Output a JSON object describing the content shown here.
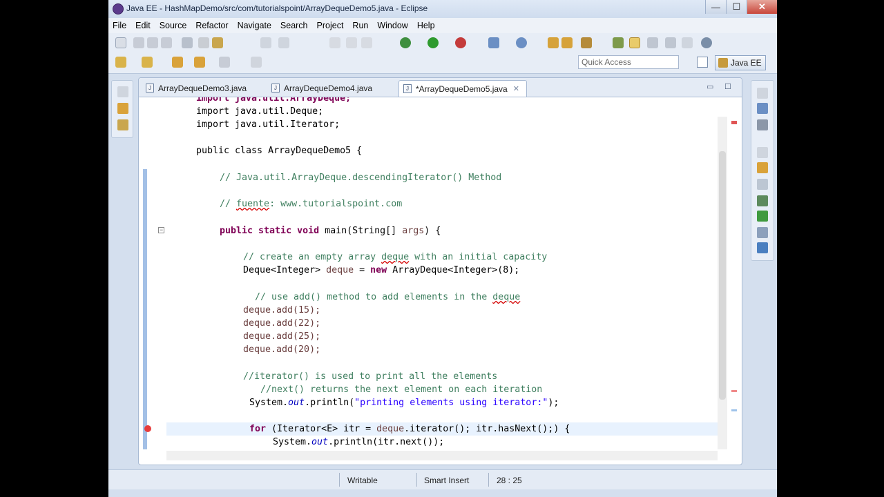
{
  "window": {
    "title": "Java EE - HashMapDemo/src/com/tutorialspoint/ArrayDequeDemo5.java - Eclipse",
    "minimize": "—",
    "maximize": "☐",
    "close": "✕"
  },
  "menu": [
    "File",
    "Edit",
    "Source",
    "Refactor",
    "Navigate",
    "Search",
    "Project",
    "Run",
    "Window",
    "Help"
  ],
  "toolbar": {
    "quick_access_placeholder": "Quick Access",
    "perspective": "Java EE"
  },
  "tabs": [
    {
      "label": "ArrayDequeDemo3.java",
      "icon_text": "J"
    },
    {
      "label": "ArrayDequeDemo4.java",
      "icon_text": "J"
    },
    {
      "label": "*ArrayDequeDemo5.java",
      "icon_text": "J",
      "close": "✕"
    }
  ],
  "code": {
    "l0": "import java.util.ArrayDeque;",
    "l1": "import java.util.Deque;",
    "l2": "import java.util.Iterator;",
    "l3": "public class ArrayDequeDemo5 {",
    "l4": "// Java.util.ArrayDeque.descendingIterator() Method",
    "l5a": "// ",
    "l5b": "fuente",
    "l5c": ": www.tutorialspoint.com",
    "l6a": "public static void",
    "l6b": " main(String[] ",
    "l6c": "args",
    "l6d": ") {",
    "l7a": "// create an empty array ",
    "l7b": "deque",
    "l7c": " with an initial capacity",
    "l8a": "Deque<Integer> ",
    "l8b": "deque",
    "l8c": " = ",
    "l8d": "new",
    "l8e": " ArrayDeque<Integer>(8);",
    "l9a": "// use add() method to add elements in the ",
    "l9b": "deque",
    "l10": "deque.add(15);",
    "l11": "deque.add(22);",
    "l12": "deque.add(25);",
    "l13": "deque.add(20);",
    "l14": "//iterator() is used to print all the elements",
    "l15": "//next() returns the next element on each iteration",
    "l16a": "System.",
    "l16b": "out",
    "l16c": ".println(",
    "l16d": "\"printing elements using iterator:\"",
    "l16e": ");",
    "l17a": "for",
    "l17b": " (Iterator<E> itr = ",
    "l17c": "deque",
    "l17d": ".iterator(); itr.hasNext();) {",
    "l18a": "System.",
    "l18b": "out",
    "l18c": ".println(",
    "l18d": "itr.next()",
    "l18e": ");"
  },
  "status": {
    "writable": "Writable",
    "insert_mode": "Smart Insert",
    "position": "28 : 25"
  }
}
